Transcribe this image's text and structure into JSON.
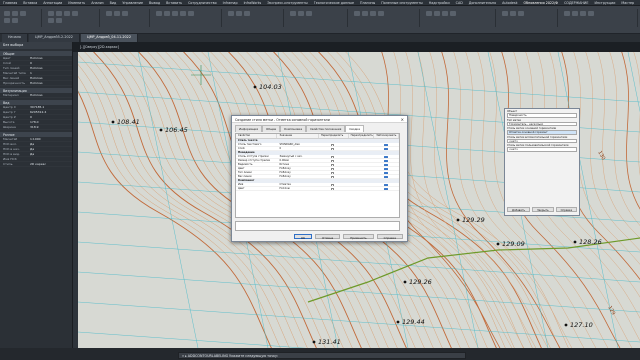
{
  "menubar": {
    "items": [
      "Главная",
      "Вставка",
      "Аннотации",
      "Изменить",
      "Анализ",
      "Вид",
      "Управление",
      "Вывод",
      "Вставить",
      "Сотрудничество",
      "Inframap",
      "InfraWorks",
      "Экспресс-инструменты",
      "Геологические данные",
      "Плагины",
      "Полезные инструменты",
      "Надстройки",
      "CAD",
      "Дополнительно",
      "Autodesk",
      "Обновления 2022/Ф",
      "СОДЕРЖАНИЕ",
      "Инструкции",
      "Мастер",
      "Справка"
    ],
    "highlight_index": 20
  },
  "tabs": {
    "items": [
      "Начало",
      "ЦМР_Андрей5-2-2022",
      "ЦМР_Андрей_04-11-2022"
    ],
    "active_index": 2
  },
  "view_label": "[-][Сверху][2D-каркас]",
  "left_panel": {
    "title": "Без выбора",
    "sections": [
      {
        "title": "Общие",
        "rows": [
          {
            "k": "Цвет",
            "v": "ПоСлою"
          },
          {
            "k": "Слой",
            "v": "0"
          },
          {
            "k": "Тип линий",
            "v": "ПоСлою"
          },
          {
            "k": "Масштаб типа",
            "v": "1"
          },
          {
            "k": "Вес линий",
            "v": "ПоСлою"
          },
          {
            "k": "Прозрачность",
            "v": "ПоСлою"
          }
        ]
      },
      {
        "title": "Визуализация",
        "rows": [
          {
            "k": "Материал",
            "v": "ПоСлою"
          }
        ]
      },
      {
        "title": "Вид",
        "rows": [
          {
            "k": "Центр X",
            "v": "307185.1"
          },
          {
            "k": "Центр Y",
            "v": "6205312.4"
          },
          {
            "k": "Центр Z",
            "v": "0"
          },
          {
            "k": "Высота",
            "v": "178.0"
          },
          {
            "k": "Ширина",
            "v": "318.9"
          }
        ]
      },
      {
        "title": "Разное",
        "rows": [
          {
            "k": "Масштаб",
            "v": "1:1000"
          },
          {
            "k": "ПСК вкл.",
            "v": "Да"
          },
          {
            "k": "ПСК в нач.",
            "v": "Да"
          },
          {
            "k": "ПСК в вид.",
            "v": "Да"
          },
          {
            "k": "Имя ПСК",
            "v": ""
          },
          {
            "k": "Стиль",
            "v": "2D каркас"
          }
        ]
      }
    ]
  },
  "canvas": {
    "point_labels": [
      "104.03",
      "108.41",
      "106.45",
      "129.29",
      "129.09",
      "128.26",
      "129.26",
      "129.44",
      "127.10",
      "131.41"
    ],
    "contour_labels": [
      "130",
      "129",
      "128"
    ]
  },
  "dialog": {
    "title": "Создание стиля метки - Отметка основной горизонтали",
    "tabs": [
      "Информация",
      "Общие",
      "Компоновка",
      "Свойства положения",
      "Сводка"
    ],
    "active_tab_index": 4,
    "columns": [
      "Свойство",
      "Значение",
      "Переопределить",
      "Переопределить",
      "Заблокировать"
    ],
    "groups": [
      {
        "name": "Стиль текста",
        "rows": [
          {
            "prop": "Стиль текстового",
            "val": "STANDARD_Alex"
          },
          {
            "prop": "Слой",
            "val": "0"
          }
        ]
      },
      {
        "name": "Поведение",
        "rows": [
          {
            "prop": "Стиль отступа стрелки",
            "val": "Замкнутый с зал."
          },
          {
            "prop": "Размер отступа стрелки",
            "val": "0.00мм"
          },
          {
            "prop": "Видимость",
            "val": "Истина"
          },
          {
            "prop": "Цвет",
            "val": "ПоБлоку"
          },
          {
            "prop": "Тип линии",
            "val": "ПоБлоку"
          },
          {
            "prop": "Вес линии",
            "val": "ПоБлоку"
          }
        ]
      },
      {
        "name": "Компонент",
        "rows": [
          {
            "prop": "Имя",
            "val": "Отметка"
          },
          {
            "prop": "Цвет",
            "val": "ПоСлою"
          }
        ]
      }
    ],
    "buttons": [
      "ОК",
      "Отмена",
      "Применить",
      "Справка"
    ]
  },
  "side_panel": {
    "label1": "Объект",
    "field1": "Поверхность",
    "label2": "Тип метки",
    "field2": "Горизонталь - несколько",
    "label3": "Стиль метки основной горизонтали",
    "field3": "Отметка основной горизонт",
    "label4": "Стиль метки вспомогательной горизонтали",
    "field4": "<нет>",
    "label5": "Стиль метки пользовательской горизонтали",
    "field5": "<нет>",
    "buttons": [
      "Добавить",
      "Закрыть",
      "Справка"
    ]
  },
  "command_line": "ADDCONTOURLABELING Укажите следующую точку:",
  "colors": {
    "canvas_bg": "#d7d9d3",
    "major_contour": "#c26a3a",
    "minor_contour": "#d8a47a",
    "cyan_line": "#3fb8c9",
    "green_line": "#6e9a2a"
  }
}
